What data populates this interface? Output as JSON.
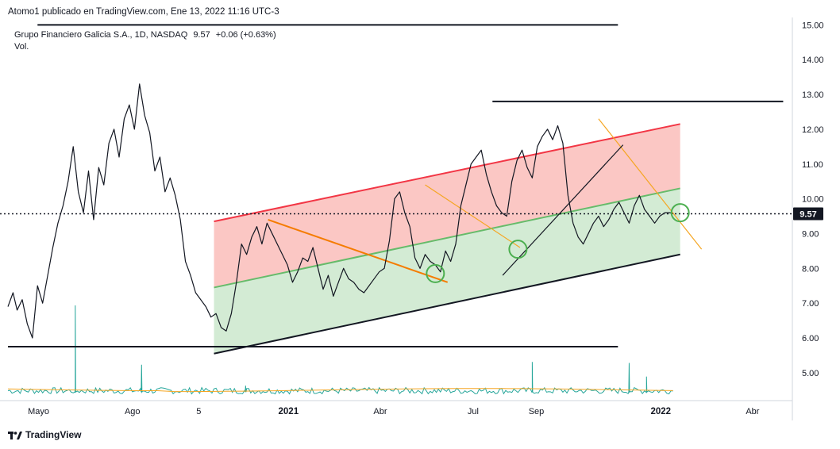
{
  "header": {
    "text": "Atomo1 publicado en TradingView.com, Ene 13, 2022 11:16 UTC-3"
  },
  "legend": {
    "symbol": "Grupo Financiero Galicia S.A., 1D, NASDAQ",
    "last": "9.57",
    "change": "+0.06 (+0.63%)",
    "volume_label": "Vol."
  },
  "footer": {
    "brand": "TradingView"
  },
  "colors": {
    "price_line": "#131722",
    "upper_band": "#f23645",
    "mid_line": "#66bb6a",
    "upper_fill": "#f9b4b0",
    "lower_fill": "#c8e6c9",
    "volume": "#26a69a",
    "volume_ma": "#f5a623",
    "orange_trend": "#f57c00",
    "circle": "#4caf50"
  },
  "chart_data": {
    "type": "line",
    "title": "",
    "y_axis_ticks": [
      5.0,
      6.0,
      7.0,
      8.0,
      9.0,
      10.0,
      11.0,
      12.0,
      13.0,
      14.0,
      15.0
    ],
    "ylim": [
      4.3,
      15.2
    ],
    "x_axis_labels": [
      {
        "label": "Mayo",
        "date": "2020-05-01",
        "bold": false
      },
      {
        "label": "Ago",
        "date": "2020-08-01",
        "bold": false
      },
      {
        "label": "5",
        "date": "2020-10-05",
        "bold": false
      },
      {
        "label": "2021",
        "date": "2021-01-01",
        "bold": true
      },
      {
        "label": "Abr",
        "date": "2021-04-01",
        "bold": false
      },
      {
        "label": "Jul",
        "date": "2021-07-01",
        "bold": false
      },
      {
        "label": "Sep",
        "date": "2021-09-01",
        "bold": false
      },
      {
        "label": "2022",
        "date": "2022-01-01",
        "bold": true
      },
      {
        "label": "Abr",
        "date": "2022-04-01",
        "bold": false
      }
    ],
    "last_price_label": "9.57",
    "last_price": 9.57,
    "price_series": {
      "x": [
        "2020-04-01",
        "2020-04-06",
        "2020-04-10",
        "2020-04-15",
        "2020-04-20",
        "2020-04-25",
        "2020-04-30",
        "2020-05-05",
        "2020-05-10",
        "2020-05-15",
        "2020-05-20",
        "2020-05-25",
        "2020-05-30",
        "2020-06-04",
        "2020-06-09",
        "2020-06-14",
        "2020-06-19",
        "2020-06-24",
        "2020-06-29",
        "2020-07-04",
        "2020-07-09",
        "2020-07-14",
        "2020-07-19",
        "2020-07-24",
        "2020-07-29",
        "2020-08-03",
        "2020-08-08",
        "2020-08-13",
        "2020-08-18",
        "2020-08-23",
        "2020-08-28",
        "2020-09-02",
        "2020-09-07",
        "2020-09-12",
        "2020-09-17",
        "2020-09-22",
        "2020-09-27",
        "2020-10-02",
        "2020-10-07",
        "2020-10-12",
        "2020-10-17",
        "2020-10-22",
        "2020-10-27",
        "2020-11-01",
        "2020-11-06",
        "2020-11-11",
        "2020-11-16",
        "2020-11-21",
        "2020-11-26",
        "2020-12-01",
        "2020-12-06",
        "2020-12-11",
        "2020-12-16",
        "2020-12-21",
        "2020-12-26",
        "2020-12-31",
        "2021-01-05",
        "2021-01-10",
        "2021-01-15",
        "2021-01-20",
        "2021-01-25",
        "2021-01-30",
        "2021-02-04",
        "2021-02-09",
        "2021-02-14",
        "2021-02-19",
        "2021-02-24",
        "2021-03-01",
        "2021-03-06",
        "2021-03-11",
        "2021-03-16",
        "2021-03-21",
        "2021-03-26",
        "2021-03-31",
        "2021-04-05",
        "2021-04-10",
        "2021-04-15",
        "2021-04-20",
        "2021-04-25",
        "2021-04-30",
        "2021-05-05",
        "2021-05-10",
        "2021-05-15",
        "2021-05-20",
        "2021-05-25",
        "2021-05-30",
        "2021-06-04",
        "2021-06-09",
        "2021-06-14",
        "2021-06-19",
        "2021-06-24",
        "2021-06-29",
        "2021-07-04",
        "2021-07-09",
        "2021-07-14",
        "2021-07-19",
        "2021-07-24",
        "2021-07-29",
        "2021-08-03",
        "2021-08-08",
        "2021-08-13",
        "2021-08-18",
        "2021-08-23",
        "2021-08-28",
        "2021-09-02",
        "2021-09-07",
        "2021-09-12",
        "2021-09-17",
        "2021-09-22",
        "2021-09-27",
        "2021-10-02",
        "2021-10-07",
        "2021-10-12",
        "2021-10-17",
        "2021-10-22",
        "2021-10-27",
        "2021-11-01",
        "2021-11-06",
        "2021-11-11",
        "2021-11-16",
        "2021-11-21",
        "2021-11-26",
        "2021-12-01",
        "2021-12-06",
        "2021-12-11",
        "2021-12-16",
        "2021-12-21",
        "2021-12-26",
        "2021-12-31",
        "2022-01-05",
        "2022-01-10",
        "2022-01-13"
      ],
      "y": [
        6.9,
        7.3,
        6.8,
        7.1,
        6.4,
        6.0,
        7.5,
        7.0,
        7.8,
        8.6,
        9.3,
        9.8,
        10.5,
        11.5,
        10.2,
        9.6,
        10.8,
        9.4,
        10.9,
        10.4,
        11.6,
        12.0,
        11.2,
        12.3,
        12.7,
        12.0,
        13.3,
        12.4,
        11.9,
        10.8,
        11.2,
        10.2,
        10.6,
        10.1,
        9.4,
        8.2,
        7.8,
        7.3,
        7.1,
        6.9,
        6.6,
        6.7,
        6.3,
        6.2,
        6.7,
        7.6,
        8.7,
        8.4,
        8.9,
        9.2,
        8.7,
        9.3,
        9.0,
        8.7,
        8.4,
        8.1,
        7.6,
        7.9,
        8.3,
        8.2,
        8.6,
        8.0,
        7.4,
        7.8,
        7.2,
        7.6,
        8.0,
        7.7,
        7.6,
        7.4,
        7.3,
        7.5,
        7.7,
        7.9,
        8.0,
        8.8,
        10.0,
        10.2,
        9.6,
        9.2,
        8.3,
        8.0,
        8.4,
        8.2,
        8.1,
        7.9,
        8.5,
        8.2,
        8.7,
        9.8,
        10.4,
        11.0,
        11.2,
        11.4,
        10.7,
        10.2,
        9.8,
        9.6,
        9.5,
        10.5,
        11.1,
        11.4,
        10.9,
        10.6,
        11.5,
        11.8,
        12.0,
        11.7,
        12.1,
        11.6,
        10.1,
        9.3,
        8.9,
        8.7,
        9.0,
        9.3,
        9.5,
        9.2,
        9.4,
        9.7,
        9.9,
        9.6,
        9.3,
        9.8,
        10.1,
        9.7,
        9.5,
        9.3,
        9.5,
        9.6,
        9.6,
        9.57
      ]
    },
    "volume_series": {
      "note_free": true,
      "x_spikes": [
        "2020-06-06",
        "2020-08-10",
        "2020-11-20",
        "2021-08-28",
        "2021-12-01",
        "2021-12-18"
      ],
      "y_spikes": [
        1.0,
        0.35,
        0.12,
        0.38,
        0.37,
        0.22
      ]
    },
    "drawings": [
      {
        "kind": "horizontal",
        "y": 15.0,
        "x_from": "2020-04-30",
        "x_to": "2021-11-20",
        "color": "#131722"
      },
      {
        "kind": "horizontal",
        "y": 12.8,
        "x_from": "2021-07-20",
        "x_to": "2022-05-01",
        "color": "#131722"
      },
      {
        "kind": "horizontal",
        "y": 5.75,
        "x_from": "2020-04-01",
        "x_to": "2021-11-20",
        "color": "#131722"
      },
      {
        "kind": "channel_top",
        "from": [
          "2020-10-20",
          9.35
        ],
        "to": [
          "2022-01-20",
          12.15
        ],
        "color": "#f23645"
      },
      {
        "kind": "channel_mid",
        "from": [
          "2020-10-20",
          7.45
        ],
        "to": [
          "2022-01-20",
          10.3
        ],
        "color": "#66bb6a"
      },
      {
        "kind": "channel_bottom",
        "from": [
          "2020-10-20",
          5.55
        ],
        "to": [
          "2022-01-20",
          8.4
        ],
        "color": "#131722"
      },
      {
        "kind": "trend",
        "from": [
          "2020-12-12",
          9.4
        ],
        "to": [
          "2021-06-06",
          7.6
        ],
        "color": "#f57c00"
      },
      {
        "kind": "trend",
        "from": [
          "2021-05-15",
          10.4
        ],
        "to": [
          "2021-08-16",
          8.6
        ],
        "color": "#f5a623"
      },
      {
        "kind": "trend",
        "from": [
          "2021-11-01",
          12.3
        ],
        "to": [
          "2022-02-10",
          8.55
        ],
        "color": "#f5a623"
      },
      {
        "kind": "trend",
        "from": [
          "2021-07-30",
          7.8
        ],
        "to": [
          "2021-11-25",
          11.55
        ],
        "color": "#131722"
      }
    ],
    "circles": [
      {
        "x": "2021-05-25",
        "y": 7.85
      },
      {
        "x": "2021-08-14",
        "y": 8.55
      },
      {
        "x": "2022-01-20",
        "y": 9.6
      }
    ]
  }
}
